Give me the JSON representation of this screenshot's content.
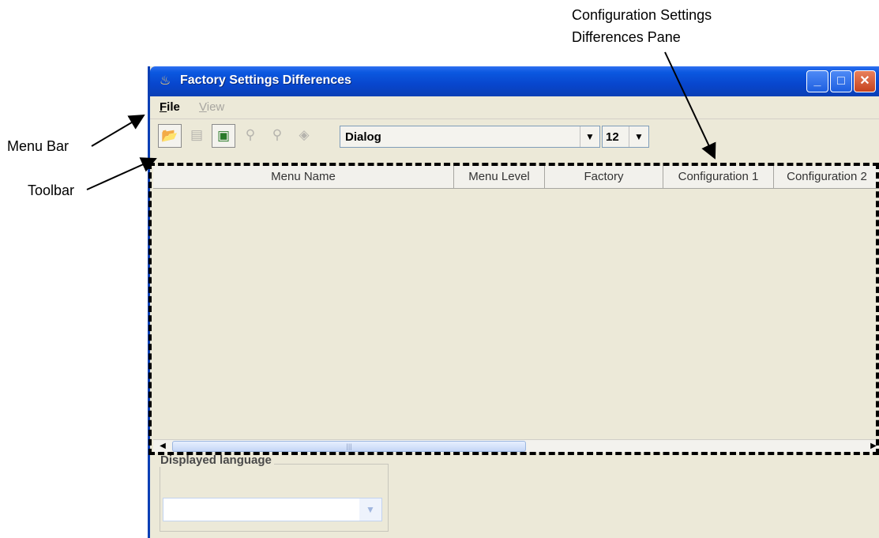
{
  "annotations": {
    "pane_label_line1": "Configuration Settings",
    "pane_label_line2": "Differences Pane",
    "menu_bar": "Menu Bar",
    "toolbar": "Toolbar"
  },
  "window": {
    "title": "Factory Settings Differences",
    "controls": {
      "minimize": "_",
      "maximize": "□",
      "close": "✕"
    }
  },
  "menubar": {
    "file_label": "File",
    "view_label": "View"
  },
  "toolbar": {
    "icons": [
      "open-folder-icon",
      "save-disk-icon",
      "export-document-icon",
      "find-icon",
      "find-next-icon",
      "print-icon"
    ],
    "font_value": "Dialog",
    "size_value": "12"
  },
  "table": {
    "columns": [
      "Menu Name",
      "Menu Level",
      "Factory",
      "Configuration 1",
      "Configuration 2"
    ],
    "rows": []
  },
  "language": {
    "group_label": "Displayed language",
    "selected": ""
  }
}
